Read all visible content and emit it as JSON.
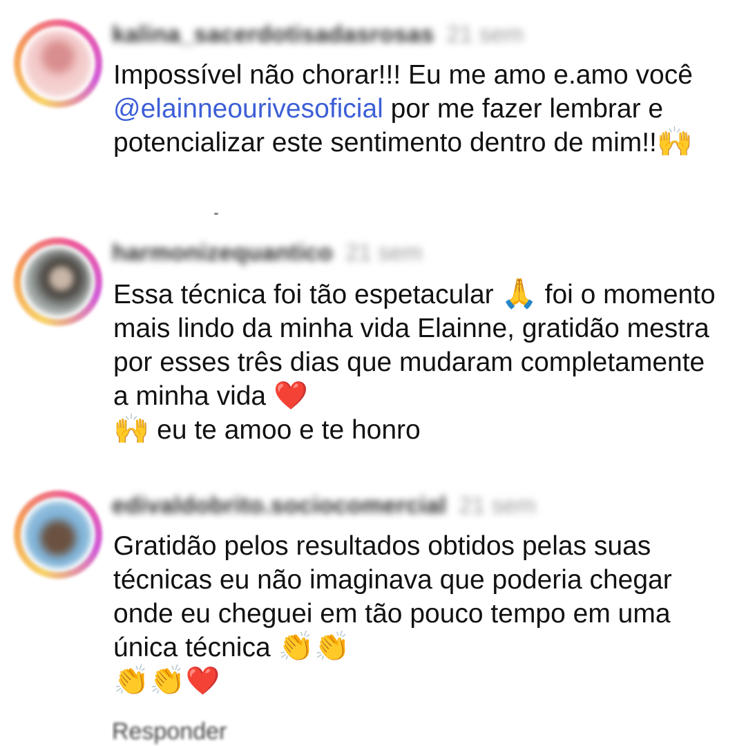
{
  "comments": [
    {
      "username": "kalina_sacerdotisadasrosas",
      "time": "21 sem",
      "text_before": "Impossível não chorar!!! Eu me amo e.amo você ",
      "mention": "@elainneourivesoficial",
      "text_after": " por me fazer lembrar e potencializar este sentimento dentro de mim!!",
      "emojis_end": "🙌",
      "avatar_colors": [
        "#f3c8c8",
        "#d98e8e"
      ]
    },
    {
      "username": "harmonizequantico",
      "time": "21 sem",
      "text_part1": "Essa técnica foi tão espetacular ",
      "emoji_pray": "🙏",
      "text_part2": " foi o momento mais lindo da minha vida Elainne, gratidão mestra por esses três dias que mudaram completamente a minha vida ",
      "emoji_heart": "❤️",
      "emoji_hands": "🙌",
      "text_part3": " eu te amoo e te honro",
      "avatar_colors": [
        "#9fa7a5",
        "#3f3a35"
      ]
    },
    {
      "username": "edivaldobrito.sociocomercial",
      "time": "21 sem",
      "text_main": "Gratidão pelos resultados obtidos pelas suas técnicas eu não imaginava que poderia chegar onde eu cheguei em tão pouco tempo em uma única técnica ",
      "emoji_clap_1": "👏",
      "emoji_clap_2": "👏",
      "emoji_clap_3": "👏",
      "emoji_clap_4": "👏",
      "emoji_heart": "❤️",
      "avatar_colors": [
        "#7fb3d8",
        "#6b5140"
      ]
    }
  ],
  "bottom_hint": "Responder",
  "colors": {
    "mention": "#3d5fd6",
    "text": "#111111",
    "timestamp": "#9a9a9a",
    "ring_start": "#f7d36b",
    "ring_end": "#d15ad8"
  }
}
